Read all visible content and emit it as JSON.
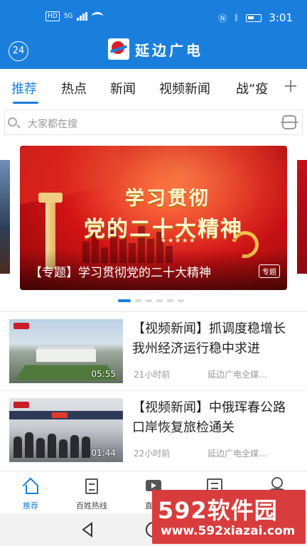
{
  "status_bar": {
    "time": "3:01",
    "network_badge": "HD",
    "signal_label": "5G"
  },
  "header": {
    "badge": "24",
    "title": "延边广电"
  },
  "tabs": [
    {
      "label": "推荐",
      "active": true
    },
    {
      "label": "热点"
    },
    {
      "label": "新闻"
    },
    {
      "label": "视频新闻"
    },
    {
      "label": "战“疫"
    }
  ],
  "tab_plus": "+",
  "search": {
    "placeholder": "大家都在搜"
  },
  "banner": {
    "headline_line1": "学习贯彻",
    "headline_line2": "党的二十大精神",
    "caption": "【专题】学习贯彻党的二十大精神",
    "tag": "专题",
    "stars": "★★★★★",
    "active_dot": 1,
    "dot_count": 6
  },
  "news": [
    {
      "title": "【视频新闻】抓调度稳增长 我州经济运行稳中求进",
      "duration": "05:55",
      "time": "21小时前",
      "source": "延边广电全媒..."
    },
    {
      "title": "【视频新闻】中俄珲春公路口岸恢复旅检通关",
      "duration": "01:44",
      "time": "22小时前",
      "source": "延边广电全媒..."
    }
  ],
  "bottom_nav": [
    {
      "label": "推荐",
      "icon": "home-icon",
      "active": true
    },
    {
      "label": "百姓热线",
      "icon": "document-icon"
    },
    {
      "label": "直播",
      "icon": "play-icon"
    },
    {
      "label": "",
      "icon": "message-icon"
    },
    {
      "label": "",
      "icon": "user-icon"
    }
  ],
  "watermark": {
    "main": "592软件园",
    "sub": "www.592xiazai.com"
  },
  "colors": {
    "primary": "#1a7fdc",
    "banner_red": "#d61416",
    "watermark": "#d93c3c"
  }
}
